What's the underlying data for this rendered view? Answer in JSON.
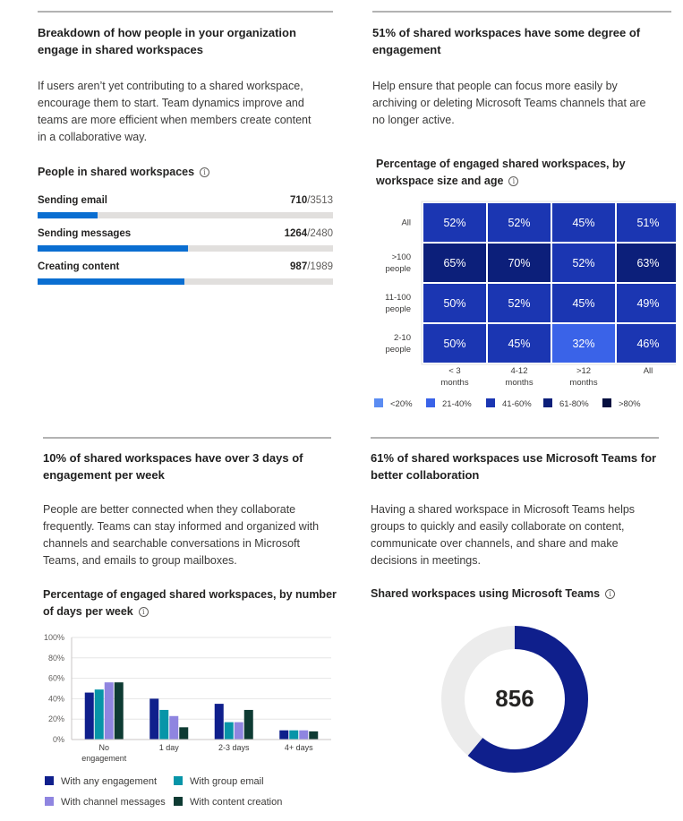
{
  "q1": {
    "title_line1": "Breakdown of how people in your organization",
    "title_line2": "engage in shared workspaces",
    "desc_lines": [
      "If users aren’t yet contributing to a shared workspace,",
      "encourage them to start. Team dynamics improve and",
      "teams are more efficient when members create content",
      "in a collaborative way."
    ],
    "subtitle": "People in shared workspaces",
    "rows": [
      {
        "label": "Sending email",
        "count": "710",
        "total": "/3513",
        "fraction": 0.2021
      },
      {
        "label": "Sending messages",
        "count": "1264",
        "total": "/2480",
        "fraction": 0.5097
      },
      {
        "label": "Creating content",
        "count": "987",
        "total": "/1989",
        "fraction": 0.4962
      }
    ]
  },
  "q2": {
    "title_line1": "51% of shared workspaces have some degree of",
    "title_line2": "engagement",
    "desc_lines": [
      "Help ensure that people can focus more easily by",
      "archiving or deleting Microsoft Teams channels that are",
      "no longer active."
    ],
    "subtitle_line1": "Percentage of engaged shared workspaces, by",
    "subtitle_line2": "workspace size and age"
  },
  "q3": {
    "title_line1": "10% of shared workspaces have over 3 days of",
    "title_line2": "engagement per week",
    "desc_lines": [
      "People are better connected when they collaborate",
      "frequently. Teams can stay informed and organized with",
      "channels and searchable conversations in Microsoft",
      "Teams, and emails to group mailboxes."
    ],
    "subtitle_line1": "Percentage of engaged shared workspaces, by number",
    "subtitle_line2": "of days per week"
  },
  "q4": {
    "title_line1": "61% of shared workspaces use Microsoft Teams for",
    "title_line2": "better collaboration",
    "desc_lines": [
      "Having a shared workspace in Microsoft Teams helps",
      "groups to quickly and easily collaborate on content,",
      "communicate over channels, and share and make",
      "decisions in meetings."
    ],
    "subtitle": "Shared workspaces using Microsoft Teams",
    "center_value": "856"
  },
  "colors": {
    "bar_fill": "#0a6ed1",
    "track": "#e1dfdd",
    "heat_lt20": "#5b8cf2",
    "heat_21_40": "#3a63e8",
    "heat_41_60": "#1b36b2",
    "heat_61_80": "#0c1f7a",
    "heat_gt80": "#061040",
    "series_any": "#0f1f8c",
    "series_group_email": "#0795a8",
    "series_channel": "#8f85e0",
    "series_content": "#0e3b33",
    "donut_fill": "#0f1f8c",
    "donut_track": "#ececec"
  },
  "chart_data": [
    {
      "type": "heatmap",
      "title": "Percentage of engaged shared workspaces, by workspace size and age",
      "rows": [
        "All",
        ">100 people",
        "11-100 people",
        "2-10 people"
      ],
      "row_label_lines": [
        [
          "All"
        ],
        [
          ">100",
          "people"
        ],
        [
          "11-100",
          "people"
        ],
        [
          "2-10",
          "people"
        ]
      ],
      "columns": [
        "< 3 months",
        "4-12 months",
        ">12 months",
        "All"
      ],
      "col_label_lines": [
        [
          "< 3",
          "months"
        ],
        [
          "4-12",
          "months"
        ],
        [
          ">12",
          "months"
        ],
        [
          "All"
        ]
      ],
      "values": [
        [
          52,
          52,
          45,
          51
        ],
        [
          65,
          70,
          52,
          63
        ],
        [
          50,
          52,
          45,
          49
        ],
        [
          50,
          45,
          32,
          46
        ]
      ],
      "cell_labels": [
        [
          "52%",
          "52%",
          "45%",
          "51%"
        ],
        [
          "65%",
          "70%",
          "52%",
          "63%"
        ],
        [
          "50%",
          "52%",
          "45%",
          "49%"
        ],
        [
          "50%",
          "45%",
          "32%",
          "46%"
        ]
      ],
      "legend": [
        "<20%",
        "21-40%",
        "41-60%",
        "61-80%",
        ">80%"
      ]
    },
    {
      "type": "bar",
      "title": "Percentage of engaged shared workspaces, by number of days per week",
      "categories": [
        "No engagement",
        "1 day",
        "2-3 days",
        "4+ days"
      ],
      "category_label_lines": [
        [
          "No",
          "engagement"
        ],
        [
          "1 day"
        ],
        [
          "2-3 days"
        ],
        [
          "4+ days"
        ]
      ],
      "series": [
        {
          "name": "With any engagement",
          "values": [
            46,
            40,
            35,
            9
          ]
        },
        {
          "name": "With group email",
          "values": [
            49,
            29,
            17,
            9
          ]
        },
        {
          "name": "With channel messages",
          "values": [
            56,
            23,
            17,
            9
          ]
        },
        {
          "name": "With content creation",
          "values": [
            56,
            12,
            29,
            8
          ]
        }
      ],
      "ylim": [
        0,
        100
      ],
      "yticks": [
        "0%",
        "20%",
        "40%",
        "60%",
        "80%",
        "100%"
      ],
      "legend_position": "bottom"
    },
    {
      "type": "pie",
      "title": "Shared workspaces using Microsoft Teams",
      "center_label": "856",
      "slices": [
        {
          "name": "Using Microsoft Teams",
          "percent": 61
        },
        {
          "name": "Not using Microsoft Teams",
          "percent": 39
        }
      ]
    }
  ]
}
